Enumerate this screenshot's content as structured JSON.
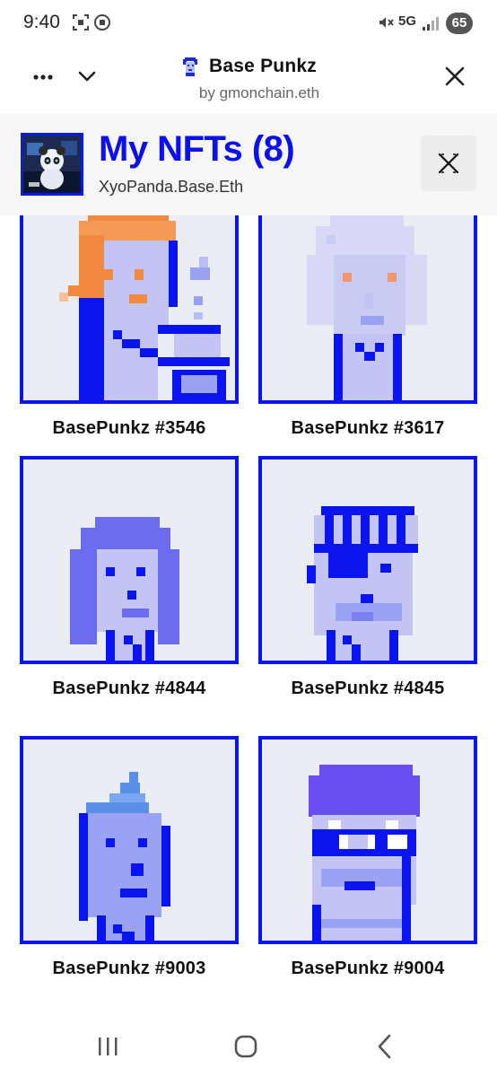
{
  "status_bar": {
    "time": "9:40",
    "network": "5G",
    "battery": "65",
    "icons": [
      "screenshot-icon",
      "app-badge-icon",
      "mute-icon",
      "signal-icon"
    ]
  },
  "browser": {
    "title": "Base Punkz",
    "subtitle": "by gmonchain.eth",
    "menu_icon": "more-dots-icon",
    "collapse_icon": "chevron-down-icon",
    "close_icon": "close-icon"
  },
  "collection": {
    "title": "My NFTs (8)",
    "owner": "XyoPanda.Base.Eth",
    "close_icon": "close-icon"
  },
  "nfts": [
    {
      "name": "BasePunkz #3546"
    },
    {
      "name": "BasePunkz #3617"
    },
    {
      "name": "BasePunkz #4844"
    },
    {
      "name": "BasePunkz #4845"
    },
    {
      "name": "BasePunkz #9003"
    },
    {
      "name": "BasePunkz #9004"
    }
  ],
  "colors": {
    "accent": "#0a10ee",
    "card_bg": "#ebedf4",
    "skin": "#c3c4f3",
    "hair_orange": "#f38a3a"
  },
  "nav_bar": {
    "recent_icon": "recent-apps-icon",
    "home_icon": "home-icon",
    "back_icon": "back-icon"
  }
}
